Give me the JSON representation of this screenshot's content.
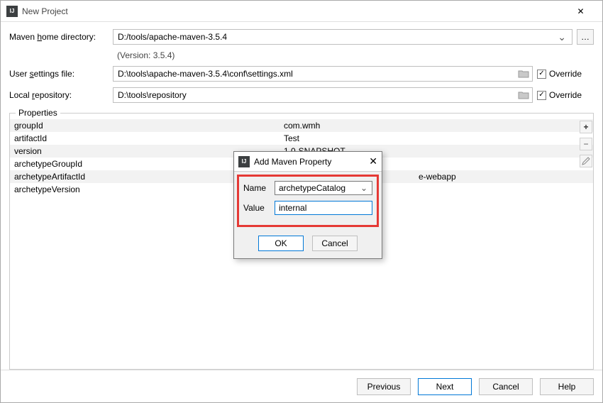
{
  "window": {
    "title": "New Project"
  },
  "fields": {
    "mavenHome": {
      "label_pre": "Maven ",
      "label_u": "h",
      "label_post": "ome directory:",
      "value": "D:/tools/apache-maven-3.5.4"
    },
    "versionNote": "(Version: 3.5.4)",
    "userSettings": {
      "label_pre": "User ",
      "label_u": "s",
      "label_post": "ettings file:",
      "value": "D:\\tools\\apache-maven-3.5.4\\conf\\settings.xml",
      "override": "Override"
    },
    "localRepo": {
      "label_pre": "Local ",
      "label_u": "r",
      "label_post": "epository:",
      "value": "D:\\tools\\repository",
      "override": "Override"
    }
  },
  "properties": {
    "groupLabel": "Properties",
    "rows": [
      {
        "k": "groupId",
        "v": "com.wmh"
      },
      {
        "k": "artifactId",
        "v": "Test"
      },
      {
        "k": "version",
        "v": "1.0-SNAPSHOT"
      },
      {
        "k": "archetypeGroupId",
        "v": ""
      },
      {
        "k": "archetypeArtifactId",
        "v": "e-webapp"
      },
      {
        "k": "archetypeVersion",
        "v": ""
      }
    ]
  },
  "buttons": {
    "previous": "Previous",
    "next": "Next",
    "cancel": "Cancel",
    "help": "Help"
  },
  "modal": {
    "title": "Add Maven Property",
    "nameLabel": "Name",
    "nameValue": "archetypeCatalog",
    "valueLabel": "Value",
    "valueValue": "internal",
    "ok": "OK",
    "cancel": "Cancel"
  }
}
